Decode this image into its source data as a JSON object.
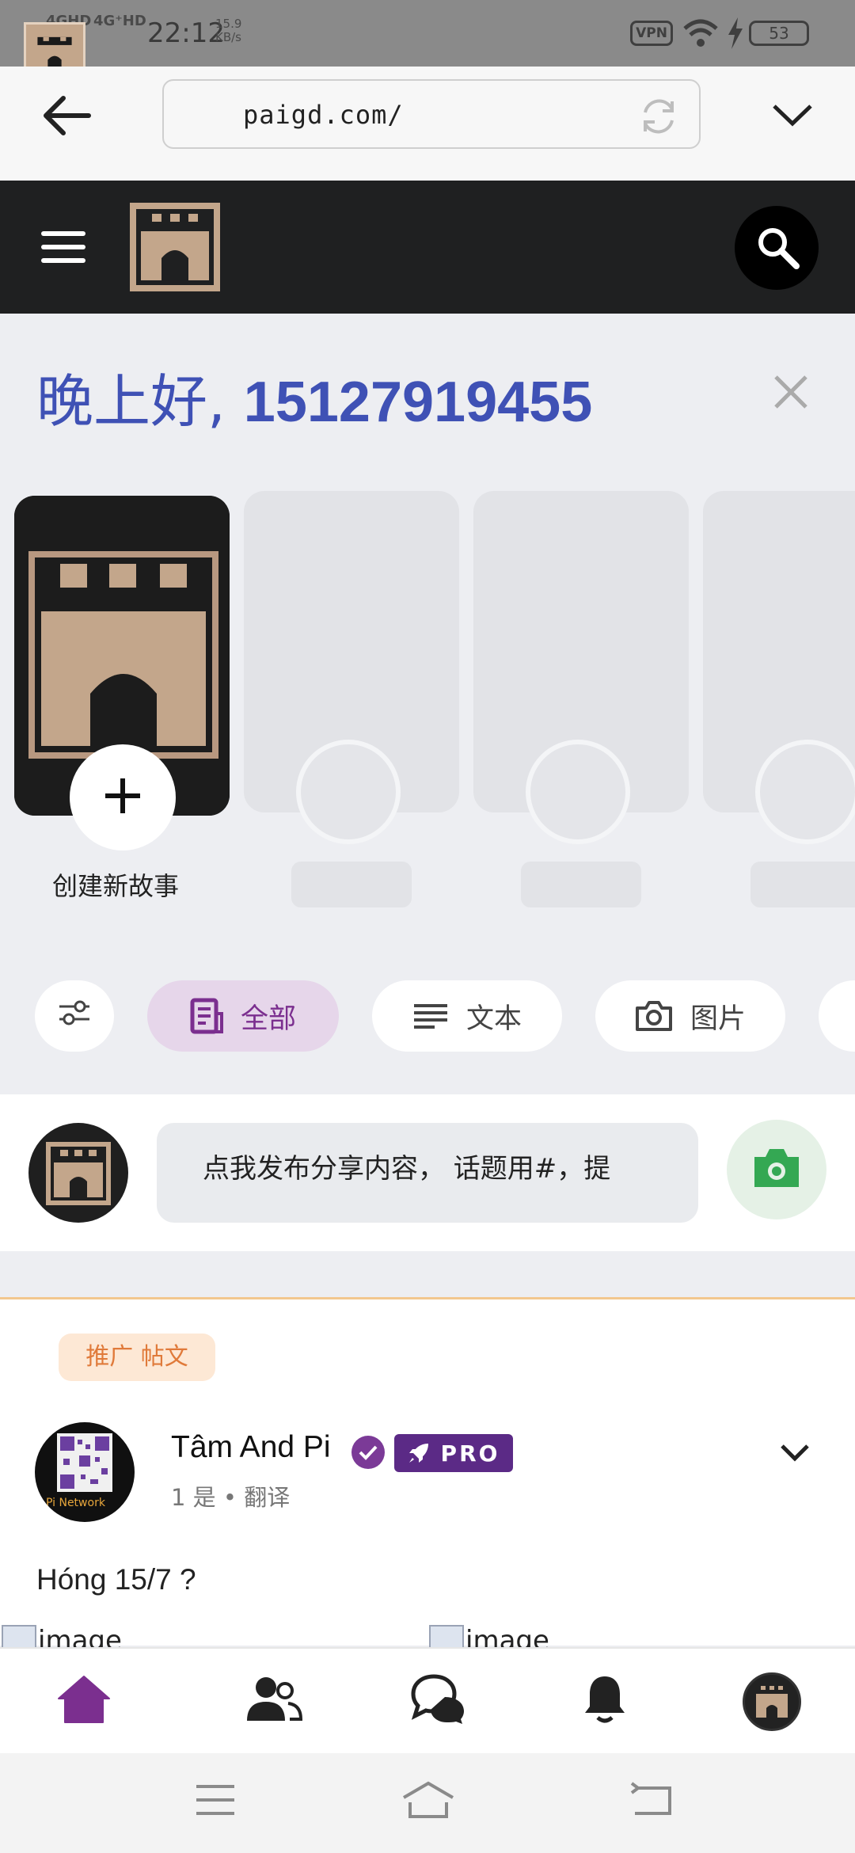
{
  "status_bar": {
    "network_1": "4GHD",
    "network_2": "4G⁺HD",
    "time": "22:12",
    "speed_value": "15.9",
    "speed_unit": "KB/s",
    "vpn": "VPN",
    "battery": "53"
  },
  "browser": {
    "url": "paigd.com/"
  },
  "greeting": {
    "prefix": "晚上好, ",
    "user": "15127919455"
  },
  "stories": {
    "create_label": "创建新故事"
  },
  "filters": {
    "all": "全部",
    "text": "文本",
    "photo": "图片"
  },
  "composer": {
    "placeholder": "点我发布分享内容， 话题用#，提"
  },
  "post": {
    "badge": "推广 帖文",
    "author": "Tâm And Pi",
    "pro": "PRO",
    "meta": "1 是 • 翻译",
    "text": "Hóng 15/7 ?",
    "image_alt_1": "image",
    "image_alt_2": "image",
    "avatar_caption": "Pi Network"
  },
  "colors": {
    "accent_purple": "#7b2f8f",
    "greeting_blue": "#3f51b5",
    "header_dark": "#1f2021",
    "promo_orange": "#e07a3a",
    "camera_green": "#34a853",
    "logo_tan": "#c3a68b"
  }
}
